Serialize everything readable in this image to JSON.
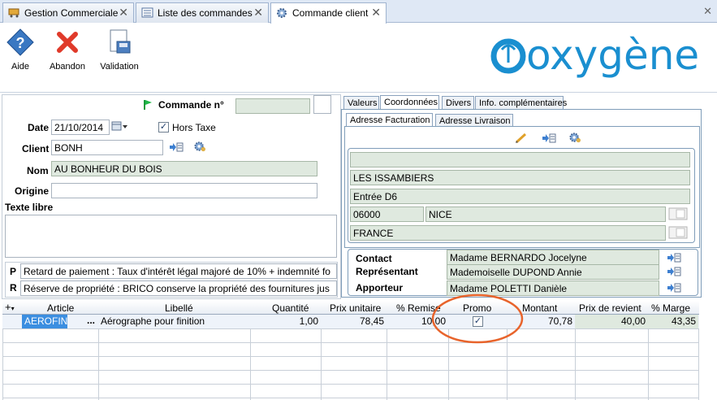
{
  "tabs": [
    {
      "label": "Gestion Commerciale",
      "icon": "cart-icon"
    },
    {
      "label": "Liste des commandes",
      "icon": "list-icon"
    },
    {
      "label": "Commande client",
      "icon": "gear-icon"
    }
  ],
  "toolbar": {
    "help": "Aide",
    "abandon": "Abandon",
    "validate": "Validation"
  },
  "logo": "oxygène",
  "form": {
    "order_no_label": "Commande n°",
    "date_label": "Date",
    "date_value": "21/10/2014",
    "hors_taxe_label": "Hors Taxe",
    "hors_taxe_checked": "✓",
    "client_label": "Client",
    "client_value": "BONH",
    "name_label": "Nom",
    "name_value": "AU BONHEUR DU BOIS",
    "origin_label": "Origine",
    "origin_value": "",
    "free_text_label": "Texte libre"
  },
  "clauses": [
    {
      "letter": "P",
      "text": "Retard de paiement : Taux d'intérêt légal majoré de 10% + indemnité fo"
    },
    {
      "letter": "R",
      "text": "Réserve de propriété : BRICO conserve la propriété des fournitures jus"
    }
  ],
  "right_tabs": [
    "Valeurs",
    "Coordonnées",
    "Divers",
    "Info. complémentaires"
  ],
  "address_tabs": [
    "Adresse Facturation",
    "Adresse Livraison"
  ],
  "address": {
    "line1": "",
    "line2": "LES ISSAMBIERS",
    "line3": "Entrée D6",
    "postal": "06000",
    "city": "NICE",
    "country": "FRANCE"
  },
  "contacts": {
    "contact_label": "Contact",
    "contact_value": "Madame BERNARDO Jocelyne",
    "rep_label": "Représentant",
    "rep_value": "Mademoiselle DUPOND Annie",
    "provider_label": "Apporteur",
    "provider_value": "Madame POLETTI Danièle"
  },
  "grid": {
    "columns": [
      "Article",
      "Libellé",
      "Quantité",
      "Prix unitaire",
      "% Remise",
      "Promo",
      "Montant",
      "Prix de revient",
      "% Marge"
    ],
    "rows": [
      {
        "article": "AEROFIN",
        "more": "...",
        "libelle": "Aérographe pour finition",
        "qty": "1,00",
        "unit_price": "78,45",
        "discount": "10,00",
        "promo": "✓",
        "amount": "70,78",
        "cost": "40,00",
        "margin": "43,35"
      }
    ]
  },
  "colors": {
    "accent": "#1a8fd0",
    "annotation": "#e8642c",
    "green_field": "#dfe9df"
  }
}
